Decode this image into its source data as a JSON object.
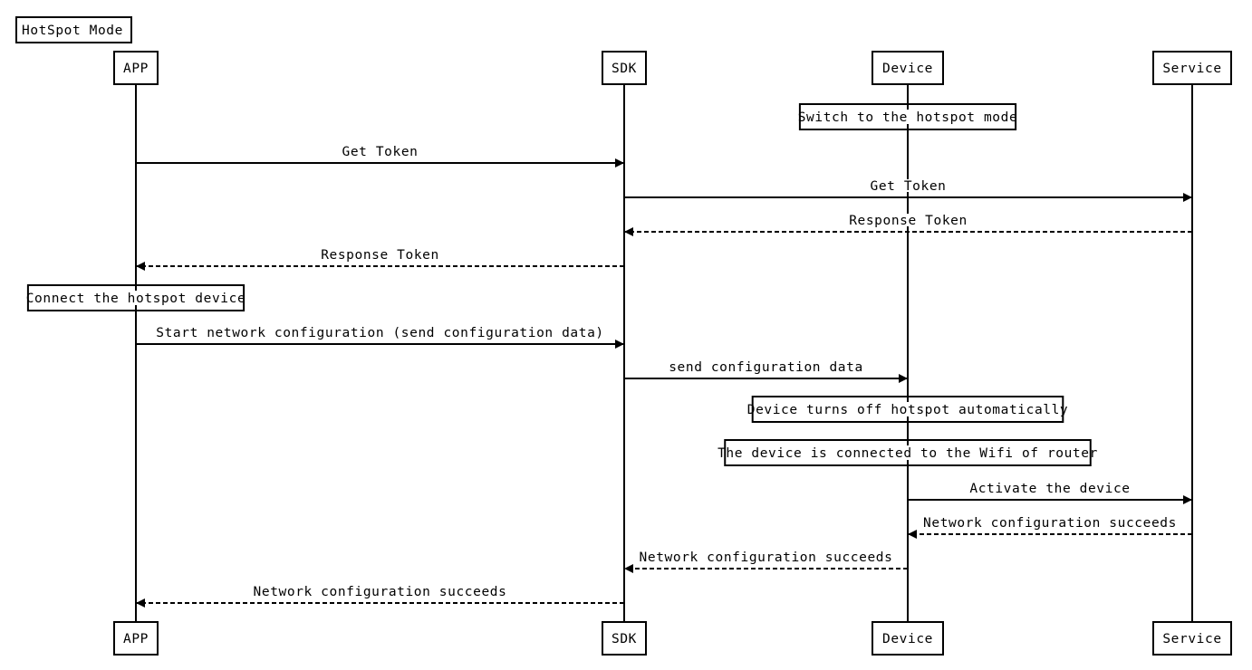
{
  "title": "HotSpot Mode",
  "participants": [
    {
      "id": "app",
      "label": "APP"
    },
    {
      "id": "sdk",
      "label": "SDK"
    },
    {
      "id": "device",
      "label": "Device"
    },
    {
      "id": "service",
      "label": "Service"
    }
  ],
  "steps": [
    {
      "type": "note",
      "over": "device",
      "text": "Switch to the hotspot mode"
    },
    {
      "type": "message",
      "from": "app",
      "to": "sdk",
      "style": "solid",
      "text": "Get Token"
    },
    {
      "type": "message",
      "from": "sdk",
      "to": "service",
      "style": "solid",
      "text": "Get Token"
    },
    {
      "type": "message",
      "from": "service",
      "to": "sdk",
      "style": "dashed",
      "text": "Response Token"
    },
    {
      "type": "message",
      "from": "sdk",
      "to": "app",
      "style": "dashed",
      "text": "Response Token"
    },
    {
      "type": "note",
      "over": "app",
      "text": "Connect the hotspot device"
    },
    {
      "type": "message",
      "from": "app",
      "to": "sdk",
      "style": "solid",
      "text": "Start network configuration (send configuration data)"
    },
    {
      "type": "message",
      "from": "sdk",
      "to": "device",
      "style": "solid",
      "text": "send configuration data"
    },
    {
      "type": "note",
      "over": "device",
      "text": "Device turns off hotspot automatically"
    },
    {
      "type": "note",
      "over": "device",
      "text": "The device is connected to the Wifi of router"
    },
    {
      "type": "message",
      "from": "device",
      "to": "service",
      "style": "solid",
      "text": "Activate the device"
    },
    {
      "type": "message",
      "from": "service",
      "to": "device",
      "style": "dashed",
      "text": "Network configuration succeeds"
    },
    {
      "type": "message",
      "from": "device",
      "to": "sdk",
      "style": "dashed",
      "text": "Network configuration succeeds"
    },
    {
      "type": "message",
      "from": "sdk",
      "to": "app",
      "style": "dashed",
      "text": "Network configuration succeeds"
    }
  ]
}
